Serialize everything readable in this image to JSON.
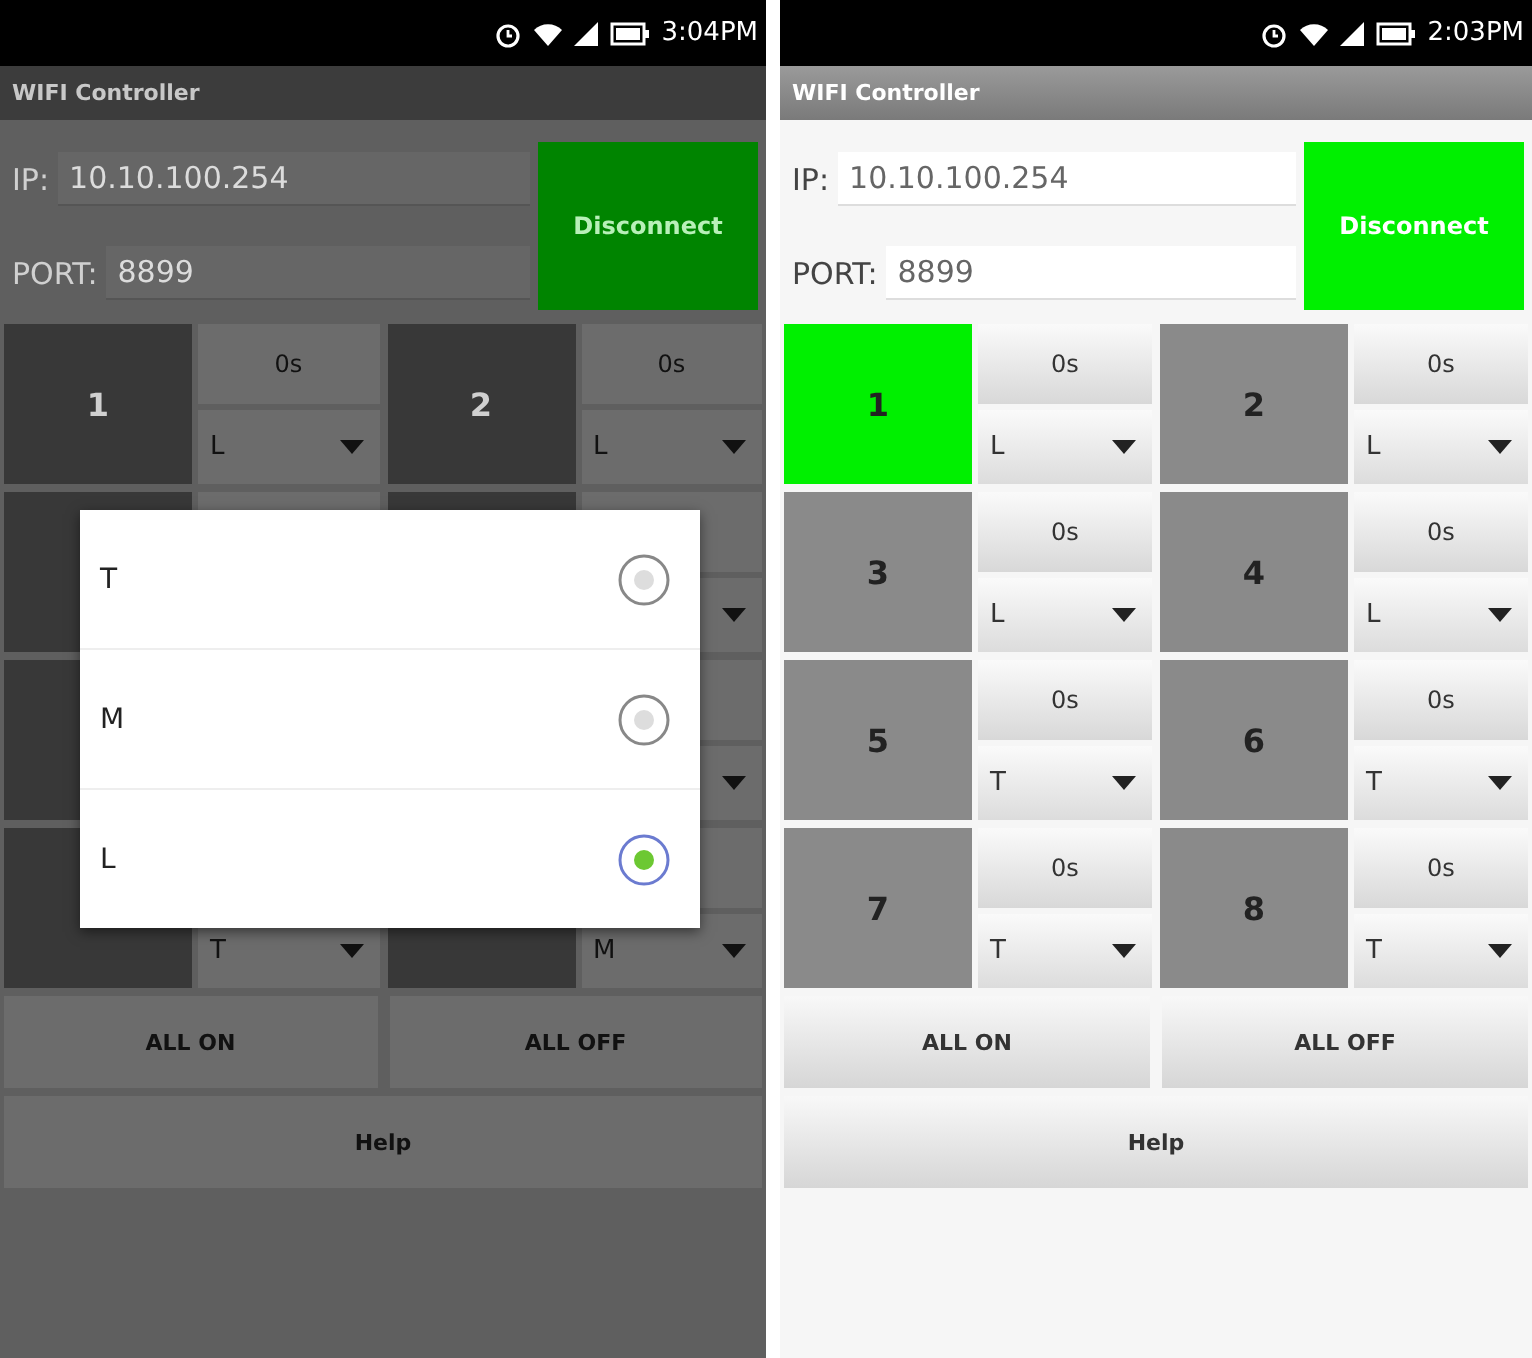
{
  "screens": [
    {
      "status_bar": {
        "time": "3:04PM"
      },
      "title": "WIFI Controller",
      "ip": {
        "label": "IP:",
        "value": "10.10.100.254"
      },
      "port": {
        "label": "PORT:",
        "value": "8899"
      },
      "connect_button": "Disconnect",
      "rows": [
        {
          "channels": [
            {
              "number": "1",
              "on": false,
              "timer": "0s",
              "mode": "L"
            },
            {
              "number": "2",
              "on": false,
              "timer": "0s",
              "mode": "L"
            }
          ]
        },
        {
          "channels": [
            {
              "on": false
            },
            {
              "on": false
            }
          ]
        },
        {
          "channels": [
            {
              "on": false
            }
          ]
        },
        {
          "channels": [
            {
              "on": false,
              "mode": "T"
            },
            {
              "on": false,
              "mode": "M"
            }
          ]
        }
      ],
      "all_on": "ALL ON",
      "all_off": "ALL OFF",
      "help": "Help",
      "dialog": {
        "options": [
          {
            "label": "T",
            "selected": false
          },
          {
            "label": "M",
            "selected": false
          },
          {
            "label": "L",
            "selected": true
          }
        ]
      }
    },
    {
      "status_bar": {
        "time": "2:03PM"
      },
      "title": "WIFI Controller",
      "ip": {
        "label": "IP:",
        "value": "10.10.100.254"
      },
      "port": {
        "label": "PORT:",
        "value": "8899"
      },
      "connect_button": "Disconnect",
      "rows": [
        {
          "channels": [
            {
              "number": "1",
              "on": true,
              "timer": "0s",
              "mode": "L"
            },
            {
              "number": "2",
              "on": false,
              "timer": "0s",
              "mode": "L"
            }
          ]
        },
        {
          "channels": [
            {
              "number": "3",
              "on": false,
              "timer": "0s",
              "mode": "L"
            },
            {
              "number": "4",
              "on": false,
              "timer": "0s",
              "mode": "L"
            }
          ]
        },
        {
          "channels": [
            {
              "number": "5",
              "on": false,
              "timer": "0s",
              "mode": "T"
            },
            {
              "number": "6",
              "on": false,
              "timer": "0s",
              "mode": "T"
            }
          ]
        },
        {
          "channels": [
            {
              "number": "7",
              "on": false,
              "timer": "0s",
              "mode": "T"
            },
            {
              "number": "8",
              "on": false,
              "timer": "0s",
              "mode": "T"
            }
          ]
        }
      ],
      "all_on": "ALL ON",
      "all_off": "ALL OFF",
      "help": "Help"
    }
  ]
}
